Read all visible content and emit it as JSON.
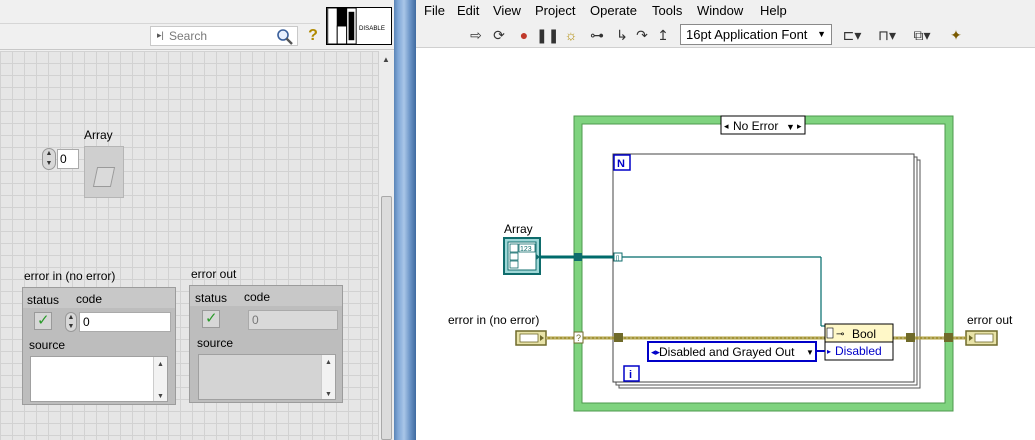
{
  "front_panel": {
    "search_placeholder": "Search",
    "help_glyph": "?",
    "vi_icon_text": "DISABLE",
    "array_label": "Array",
    "array_index_value": "0",
    "error_in": {
      "label": "error in (no error)",
      "status_label": "status",
      "code_label": "code",
      "code_value": "0",
      "source_label": "source",
      "status_checked": true
    },
    "error_out": {
      "label": "error out",
      "status_label": "status",
      "code_label": "code",
      "code_value": "0",
      "source_label": "source",
      "status_checked": true
    }
  },
  "block_diagram": {
    "menu": [
      "File",
      "Edit",
      "View",
      "Project",
      "Operate",
      "Tools",
      "Window",
      "Help"
    ],
    "font_select_value": "16pt Application Font",
    "toolbar_icons": [
      "run-arrow-icon",
      "run-continuously-icon",
      "abort-icon",
      "pause-icon",
      "highlight-execution-icon",
      "retain-wire-values-icon",
      "step-into-icon",
      "step-over-icon",
      "step-out-icon",
      "align-objects-icon",
      "distribute-objects-icon",
      "reorder-icon",
      "cleanup-diagram-icon"
    ],
    "case_selector": "No Error",
    "loop_count_label": "N",
    "loop_iteration_label": "i",
    "array_label": "Array",
    "array_terminal_type": "123",
    "error_in_label": "error in (no error)",
    "error_out_label": "error out",
    "property_node_class": "Bool",
    "property_disabled": "Disabled",
    "enum_constant": "Disabled and Grayed Out",
    "tunnel_marker": "?",
    "index_tunnel_marker": "[]",
    "colors": {
      "case_border": "#7fd37f",
      "wire_numeric": "#006b6b",
      "wire_error": "#b5a33a",
      "enum_wire": "#0000c8"
    }
  }
}
